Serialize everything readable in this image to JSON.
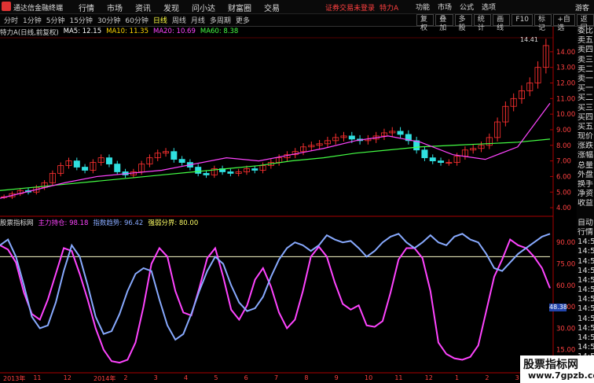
{
  "titlebar": {
    "app_title": "通达信金融终端",
    "nav": [
      "行情",
      "市场",
      "资讯",
      "发现",
      "问小达",
      "财富圈",
      "交易"
    ],
    "status_text": "证券交易未登录",
    "stock": "特力A",
    "right_menu": [
      "功能",
      "市场",
      "公式",
      "选项"
    ],
    "guest": "游客"
  },
  "toolbar": {
    "periods": [
      "分时",
      "1分钟",
      "5分钟",
      "15分钟",
      "30分钟",
      "60分钟",
      "日线",
      "周线",
      "月线",
      "多周期",
      "更多"
    ],
    "active_period": "日线",
    "tools": [
      "复权",
      "叠加",
      "多股",
      "统计",
      "画线",
      "F10",
      "标记",
      "+自选",
      "返回"
    ]
  },
  "ma_legend": {
    "name": "特力A(日线,前复权)",
    "ma5": "MA5: 12.15",
    "ma10": "MA10: 11.35",
    "ma20": "MA20: 10.69",
    "ma60": "MA60: 8.38"
  },
  "indicator_legend": {
    "name": "股票指标网",
    "a": "主力持仓: 98.18",
    "b": "指数趋势: 96.42",
    "c": "强弱分界: 80.00"
  },
  "price_axis": [
    "14.00",
    "13.00",
    "12.00",
    "11.00",
    "10.00",
    "9.00",
    "8.00",
    "7.00",
    "6.00",
    "5.00",
    "4.00"
  ],
  "ind_axis": [
    "90.00",
    "75.00",
    "60.00",
    "45.00",
    "30.00",
    "15.00"
  ],
  "max_label": "14.41",
  "current_marker": "48.38",
  "right_panel": [
    "委比",
    "卖五",
    "卖四",
    "卖三",
    "卖二",
    "卖一",
    "买一",
    "买二",
    "买三",
    "买四",
    "买五",
    "现价",
    "涨跌",
    "涨幅",
    "总量",
    "外盘",
    "换手",
    "净资",
    "收益",
    "",
    "自动",
    "行情",
    "14:5",
    "14:5",
    "14:5",
    "14:5",
    "14:5",
    "14:5",
    "14:5",
    "14:5",
    "14:5",
    "14:5",
    "14:5",
    "14:5",
    "14:5"
  ],
  "x_labels": [
    "2013年",
    "11",
    "12",
    "2014年",
    "2",
    "3",
    "4",
    "5",
    "6",
    "7",
    "8",
    "9",
    "10",
    "11",
    "12",
    "1",
    "2",
    "3"
  ],
  "chart_data": {
    "type": "candlestick",
    "price_range": [
      3.6,
      14.8
    ],
    "indicator_range": [
      0,
      100
    ],
    "threshold": 80,
    "series": [
      {
        "name": "主力持仓",
        "color": "#ff44ff",
        "values": [
          88,
          85,
          76,
          55,
          40,
          36,
          50,
          68,
          86,
          84,
          68,
          50,
          30,
          15,
          7,
          6,
          8,
          20,
          45,
          75,
          86,
          80,
          56,
          41,
          39,
          58,
          79,
          86,
          66,
          43,
          36,
          46,
          64,
          72,
          59,
          41,
          30,
          36,
          56,
          80,
          87,
          80,
          62,
          47,
          43,
          46,
          32,
          31,
          35,
          55,
          78,
          86,
          86,
          79,
          56,
          20,
          12,
          9,
          8,
          10,
          18,
          42,
          66,
          78,
          92,
          88,
          86,
          80,
          72,
          58
        ]
      },
      {
        "name": "指数趋势",
        "color": "#88aaff",
        "values": [
          88,
          92,
          80,
          60,
          38,
          30,
          32,
          48,
          70,
          88,
          80,
          60,
          38,
          26,
          28,
          40,
          56,
          68,
          72,
          70,
          50,
          32,
          22,
          26,
          40,
          56,
          70,
          80,
          75,
          60,
          48,
          42,
          44,
          52,
          66,
          78,
          86,
          90,
          88,
          84,
          88,
          95,
          92,
          90,
          91,
          86,
          80,
          84,
          90,
          94,
          96,
          90,
          86,
          90,
          95,
          90,
          88,
          94,
          96,
          92,
          90,
          82,
          72,
          70,
          76,
          82,
          86,
          90,
          94,
          96
        ]
      },
      {
        "name": "MA60",
        "color": "#44ff44",
        "values": [
          5.1,
          5.3,
          5.5,
          5.7,
          5.9,
          6.1,
          6.3,
          6.5,
          6.7,
          7.0,
          7.2,
          7.5,
          7.7,
          7.9,
          8.0,
          8.1,
          8.2,
          8.4
        ]
      },
      {
        "name": "MA20",
        "color": "#ff44ff",
        "values": [
          4.6,
          5.1,
          5.6,
          6.0,
          6.2,
          6.4,
          6.8,
          7.2,
          7.0,
          7.4,
          7.8,
          8.3,
          8.6,
          8.2,
          7.4,
          7.1,
          7.9,
          10.7
        ]
      }
    ],
    "candles": [
      4.7,
      4.9,
      5.1,
      5.0,
      5.3,
      5.6,
      6.2,
      6.7,
      7.0,
      6.6,
      6.4,
      6.9,
      7.2,
      6.8,
      6.3,
      6.1,
      6.3,
      6.8,
      7.2,
      7.5,
      7.6,
      7.1,
      6.9,
      6.6,
      6.2,
      6.1,
      6.5,
      6.3,
      6.2,
      6.3,
      6.5,
      6.4,
      6.7,
      6.9,
      7.2,
      7.4,
      7.6,
      7.9,
      8.0,
      8.1,
      8.3,
      8.5,
      8.6,
      8.4,
      8.3,
      8.4,
      8.6,
      8.8,
      8.9,
      8.7,
      8.3,
      7.7,
      7.2,
      7.0,
      6.9,
      6.9,
      7.3,
      7.7,
      7.8,
      8.0,
      8.5,
      9.5,
      10.5,
      11.0,
      11.5,
      12.0,
      13.0,
      14.4
    ]
  }
}
